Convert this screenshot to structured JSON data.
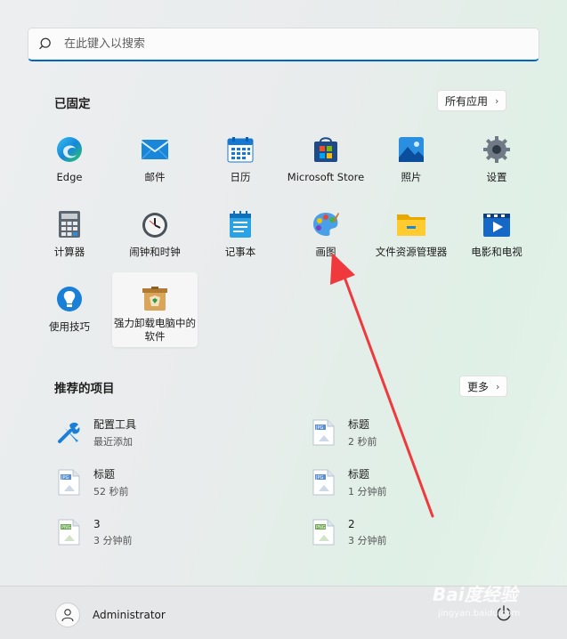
{
  "search": {
    "placeholder": "在此键入以搜索"
  },
  "pinned": {
    "title": "已固定",
    "all_apps_label": "所有应用",
    "apps": [
      {
        "label": "Edge",
        "icon": "edge-icon"
      },
      {
        "label": "邮件",
        "icon": "mail-icon"
      },
      {
        "label": "日历",
        "icon": "calendar-icon"
      },
      {
        "label": "Microsoft Store",
        "icon": "store-icon"
      },
      {
        "label": "照片",
        "icon": "photos-icon"
      },
      {
        "label": "设置",
        "icon": "settings-icon"
      },
      {
        "label": "计算器",
        "icon": "calculator-icon"
      },
      {
        "label": "闹钟和时钟",
        "icon": "clock-icon"
      },
      {
        "label": "记事本",
        "icon": "notepad-icon"
      },
      {
        "label": "画图",
        "icon": "paint-icon"
      },
      {
        "label": "文件资源管理器",
        "icon": "folder-icon"
      },
      {
        "label": "电影和电视",
        "icon": "movies-icon"
      },
      {
        "label": "使用技巧",
        "icon": "tips-icon"
      },
      {
        "label": "强力卸载电脑中的软件",
        "icon": "uninstall-icon"
      }
    ]
  },
  "recommended": {
    "title": "推荐的项目",
    "more_label": "更多",
    "items": [
      {
        "title": "配置工具",
        "subtitle": "最近添加",
        "icon": "tools-icon"
      },
      {
        "title": "标题",
        "subtitle": "2 秒前",
        "icon": "jpg-file-icon"
      },
      {
        "title": "标题",
        "subtitle": "52 秒前",
        "icon": "jpg-file-icon"
      },
      {
        "title": "标题",
        "subtitle": "1 分钟前",
        "icon": "jpg-file-icon"
      },
      {
        "title": "3",
        "subtitle": "3 分钟前",
        "icon": "png-file-icon"
      },
      {
        "title": "2",
        "subtitle": "3 分钟前",
        "icon": "png-file-icon"
      }
    ]
  },
  "footer": {
    "user_name": "Administrator"
  },
  "watermark": {
    "logo": "Bai度经验",
    "url": "jingyan.baidu.com"
  },
  "colors": {
    "accent": "#0067c0",
    "arrow": "#f0393c"
  }
}
